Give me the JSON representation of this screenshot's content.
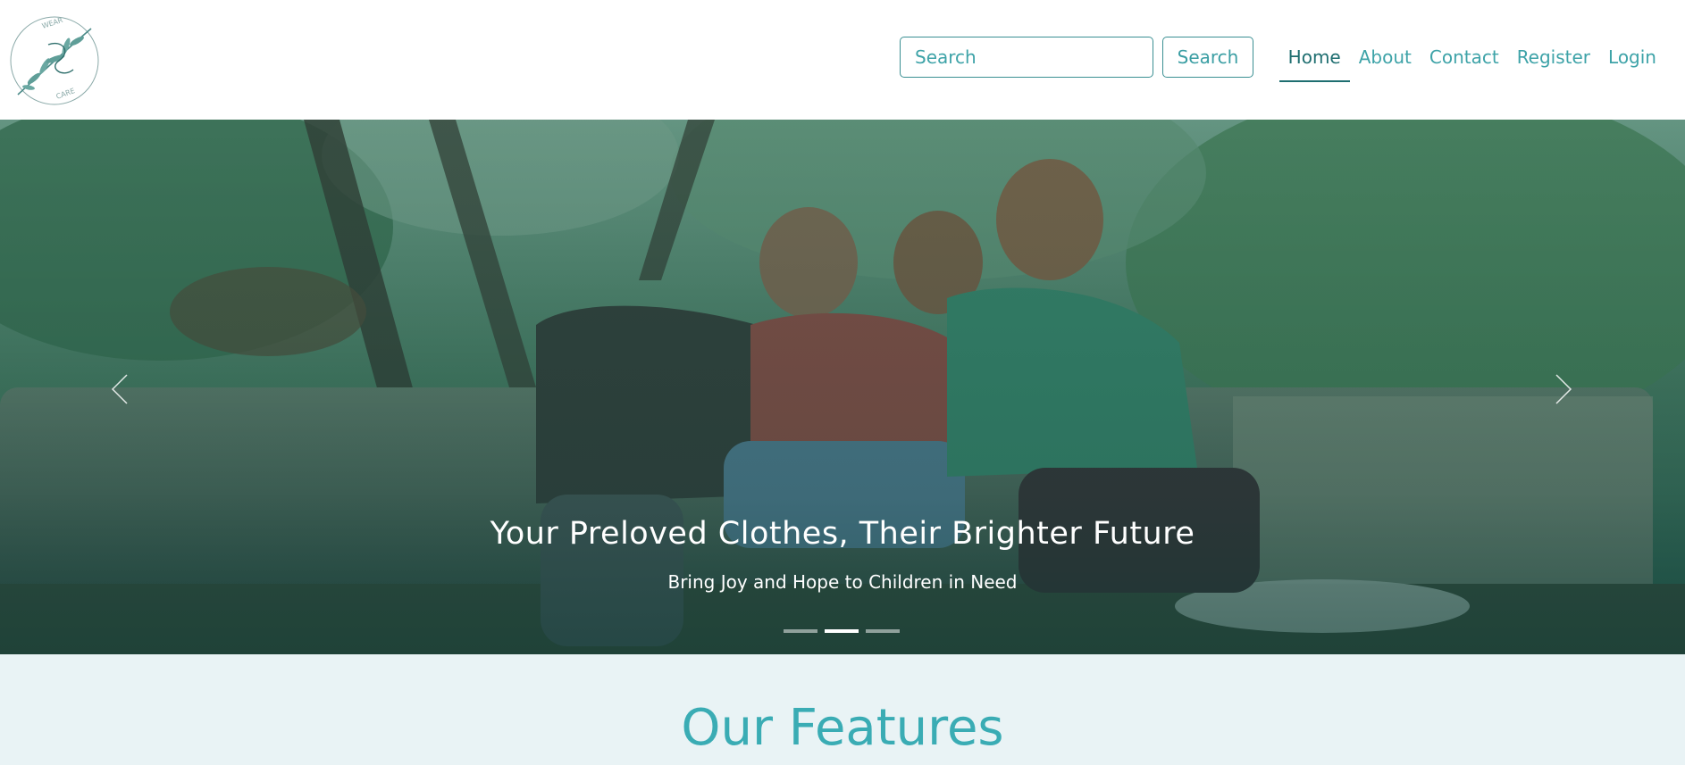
{
  "brand": {
    "logo_text_top": "WEAR",
    "logo_text_bottom": "CARE",
    "logo_icon": "leaf-branch-logo"
  },
  "search": {
    "placeholder": "Search",
    "button_label": "Search"
  },
  "nav": {
    "items": [
      {
        "label": "Home",
        "active": true
      },
      {
        "label": "About",
        "active": false
      },
      {
        "label": "Contact",
        "active": false
      },
      {
        "label": "Register",
        "active": false
      },
      {
        "label": "Login",
        "active": false
      }
    ]
  },
  "hero": {
    "title": "Your Preloved Clothes, Their Brighter Future",
    "subtitle": "Bring Joy and Hope to Children in Need",
    "prev_icon": "chevron-left-icon",
    "next_icon": "chevron-right-icon",
    "slides_count": 3,
    "active_slide": 2
  },
  "features": {
    "title": "Our Features"
  },
  "colors": {
    "accent": "#3ea3a8",
    "accent_dark": "#1e6e70",
    "features_bg": "#e9f3f5",
    "features_title": "#3aacb4"
  }
}
